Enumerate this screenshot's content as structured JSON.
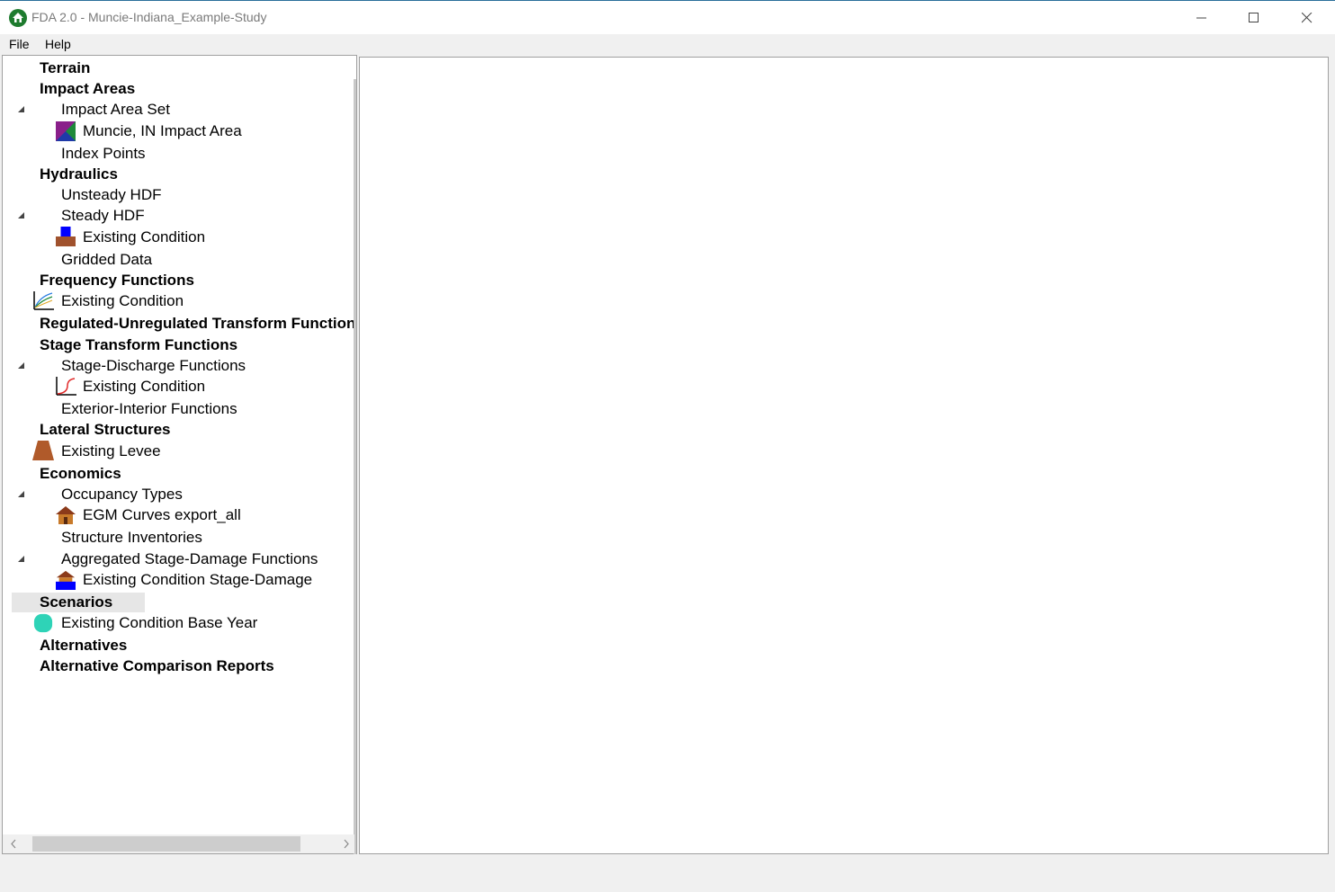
{
  "window": {
    "title": "FDA 2.0 - Muncie-Indiana_Example-Study",
    "app_icon": "house-icon",
    "controls": [
      "minimize-icon",
      "maximize-icon",
      "close-icon"
    ]
  },
  "menu": {
    "file": "File",
    "help": "Help"
  },
  "tree": {
    "terrain": "Terrain",
    "impact_areas": "Impact Areas",
    "impact_area_set": "Impact Area Set",
    "muncie_impact_area": "Muncie, IN Impact Area",
    "index_points": "Index Points",
    "hydraulics": "Hydraulics",
    "unsteady_hdf": "Unsteady HDF",
    "steady_hdf": "Steady HDF",
    "steady_existing_condition": "Existing Condition",
    "gridded_data": "Gridded Data",
    "frequency_functions": "Frequency Functions",
    "frequency_existing_condition": "Existing Condition",
    "reg_unreg": "Regulated-Unregulated Transform Functions",
    "stage_transform": "Stage Transform Functions",
    "stage_discharge": "Stage-Discharge Functions",
    "stage_discharge_existing": "Existing Condition",
    "exterior_interior": "Exterior-Interior Functions",
    "lateral_structures": "Lateral Structures",
    "existing_levee": "Existing Levee",
    "economics": "Economics",
    "occupancy_types": "Occupancy Types",
    "egm_curves": "EGM Curves export_all",
    "structure_inventories": "Structure Inventories",
    "aggregated_stage_damage": "Aggregated Stage-Damage Functions",
    "existing_stage_damage": "Existing Condition Stage-Damage",
    "scenarios": "Scenarios",
    "existing_base_year": "Existing Condition Base Year",
    "alternatives": "Alternatives",
    "alt_comparison": "Alternative Comparison Reports"
  },
  "colors": {
    "impact_area_icon": [
      "#5a1f8a",
      "#1f8a3a",
      "#1f3aa8"
    ],
    "hydraulic_icon": [
      "#0000ff",
      "#a0522d"
    ],
    "levee_icon": "#b05a2a",
    "scenario_icon": "#2ed3b7",
    "app_icon": "#1e7b2e"
  }
}
